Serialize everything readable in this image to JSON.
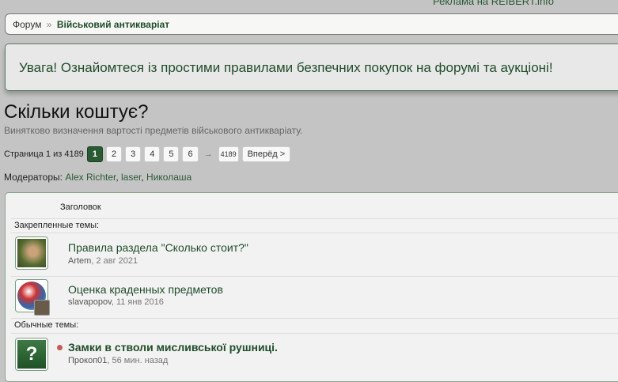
{
  "ad": "Реклама на REIBERT.info",
  "breadcrumb": {
    "root": "Форум",
    "sep": "»",
    "current": "Військовий антикваріат"
  },
  "notice": "Увага! Ознайомтеся із простими правилами безпечних покупок на форумі та аукціоні!",
  "forum": {
    "title": "Скільки коштує?",
    "description": "Винятково визначення вартості предметів військового антикваріату."
  },
  "pager": {
    "label": "Страница 1 из 4189",
    "pages": [
      "1",
      "2",
      "3",
      "4",
      "5",
      "6"
    ],
    "arrow": "→",
    "last": "4189",
    "next": "Вперёд >"
  },
  "moderators": {
    "label": "Модераторы:",
    "names": [
      "Alex Richter",
      ", ",
      "laser",
      ", ",
      "Николаша"
    ]
  },
  "list": {
    "header": "Заголовок",
    "sticky_label": "Закрепленные темы:",
    "normal_label": "Обычные темы:",
    "threads": [
      {
        "title": "Правила раздела \"Сколько стоит?\"",
        "author": "Artem",
        "date": ", 2 авг 2021"
      },
      {
        "title": "Оценка краденных предметов",
        "author": "slavapopov",
        "date": ", 11 янв 2016"
      },
      {
        "title": "Замки в стволи мисливської рушниці.",
        "author": "Прокоп01",
        "date": ", 56 мин. назад",
        "icon": "?"
      }
    ]
  }
}
